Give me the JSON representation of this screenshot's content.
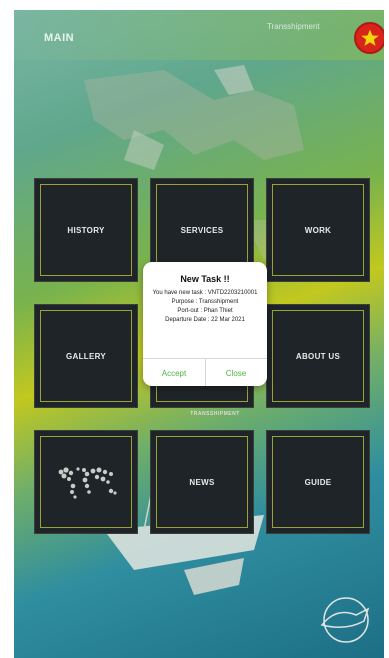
{
  "header": {
    "title": "MAIN",
    "subtitle": "Transshipment",
    "flag_icon": "vietnam-flag-icon"
  },
  "tiles": [
    {
      "label": "HISTORY"
    },
    {
      "label": "SERVICES"
    },
    {
      "label": "WORK"
    },
    {
      "label": "GALLERY"
    },
    {
      "label": "TRANSSHIPMENT"
    },
    {
      "label": "ABOUT US"
    },
    {
      "label": "",
      "icon": "world-map-icon"
    },
    {
      "label": "NEWS"
    },
    {
      "label": "GUIDE"
    }
  ],
  "modal": {
    "title": "New Task !!",
    "line1": "You have new task : VNTD2203210001",
    "line2": "Purpose : Transshipment",
    "line3": "Port-out : Phan Thiet",
    "line4": "Departure Date : 22 Mar 2021",
    "accept_label": "Accept",
    "close_label": "Close"
  },
  "colors": {
    "tile_bg": "#1f2429",
    "tile_border": "#9aa339",
    "accent_green": "#49b640",
    "flag_red": "#d9241b",
    "star_yellow": "#f5d60a"
  }
}
